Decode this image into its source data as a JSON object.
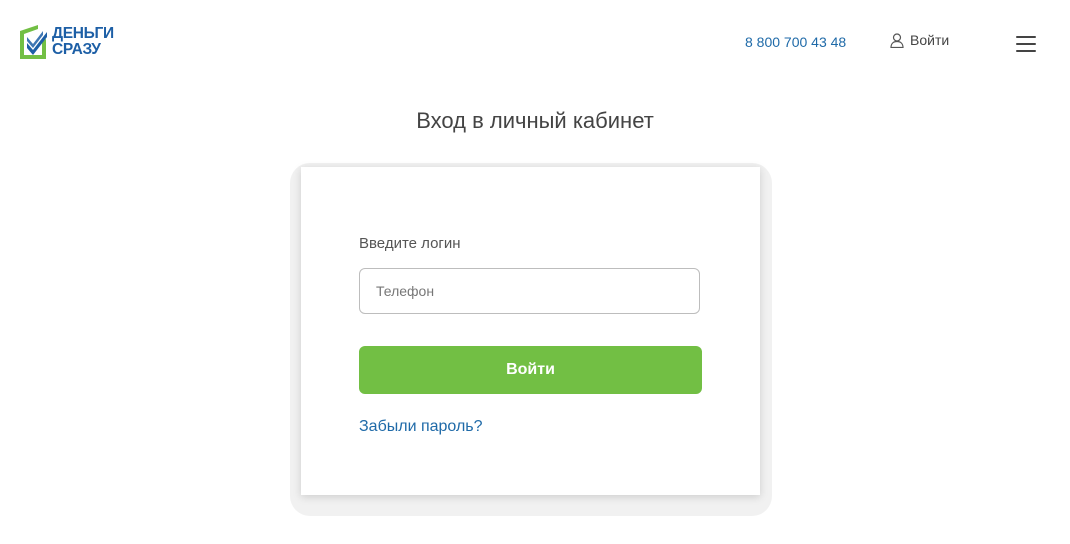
{
  "header": {
    "logo": {
      "line1": "ДЕНЬГИ",
      "line2": "СРАЗУ",
      "brand_blue": "#1d5fa6",
      "brand_green": "#72bf44"
    },
    "phone": "8 800 700 43 48",
    "login_label": "Войти",
    "user_icon": "user-icon",
    "menu_icon": "hamburger-menu-icon"
  },
  "main": {
    "title": "Вход в личный кабинет",
    "form": {
      "login_label": "Введите логин",
      "phone_placeholder": "Телефон",
      "phone_value": "",
      "submit_label": "Войти",
      "forgot_label": "Забыли пароль?"
    }
  },
  "colors": {
    "accent_green": "#72bf44",
    "link_blue": "#1f6aa8",
    "text_gray": "#444444"
  }
}
